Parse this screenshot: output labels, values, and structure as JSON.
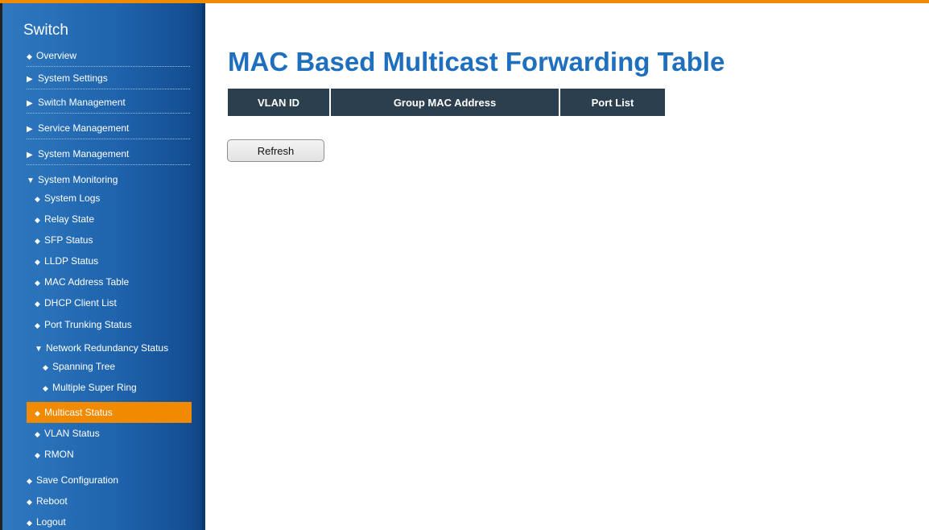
{
  "sidebar": {
    "title": "Switch",
    "items": [
      {
        "label": "Overview",
        "marker": "◆"
      },
      {
        "label": "System Settings",
        "marker": "▶"
      },
      {
        "label": "Switch Management",
        "marker": "▶"
      },
      {
        "label": "Service Management",
        "marker": "▶"
      },
      {
        "label": "System Management",
        "marker": "▶"
      },
      {
        "label": "System Monitoring",
        "marker": "▼"
      },
      {
        "label": "System Logs",
        "marker": "◆"
      },
      {
        "label": "Relay State",
        "marker": "◆"
      },
      {
        "label": "SFP Status",
        "marker": "◆"
      },
      {
        "label": "LLDP Status",
        "marker": "◆"
      },
      {
        "label": "MAC Address Table",
        "marker": "◆"
      },
      {
        "label": "DHCP Client List",
        "marker": "◆"
      },
      {
        "label": "Port Trunking Status",
        "marker": "◆"
      },
      {
        "label": "Network Redundancy Status",
        "marker": "▼"
      },
      {
        "label": "Spanning Tree",
        "marker": "◆"
      },
      {
        "label": "Multiple Super Ring",
        "marker": "◆"
      },
      {
        "label": "Multicast Status",
        "marker": "◆"
      },
      {
        "label": "VLAN Status",
        "marker": "◆"
      },
      {
        "label": "RMON",
        "marker": "◆"
      },
      {
        "label": "Save Configuration",
        "marker": "◆"
      },
      {
        "label": "Reboot",
        "marker": "◆"
      },
      {
        "label": "Logout",
        "marker": "◆"
      }
    ]
  },
  "main": {
    "title": "MAC Based Multicast Forwarding Table",
    "columns": [
      "VLAN ID",
      "Group MAC Address",
      "Port List"
    ],
    "refresh_label": "Refresh"
  },
  "colors": {
    "accent": "#f08a00",
    "sidebar": "#1f64ad",
    "title": "#1f6fbf",
    "table_header": "#2b3f4e"
  }
}
